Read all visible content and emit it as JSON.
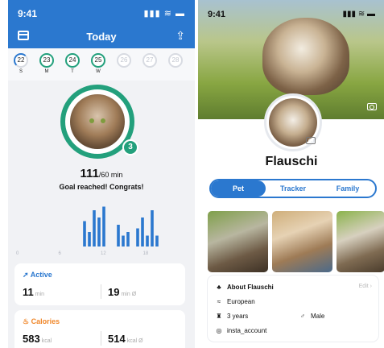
{
  "left": {
    "status_time": "9:41",
    "status_icons": "▮▮▮ ≋ ▬",
    "nav_title": "Today",
    "days": [
      {
        "num": "22",
        "label": "S",
        "state": "ring"
      },
      {
        "num": "23",
        "label": "M",
        "state": "done"
      },
      {
        "num": "24",
        "label": "T",
        "state": "done"
      },
      {
        "num": "25",
        "label": "W",
        "state": "done"
      },
      {
        "num": "26",
        "label": "",
        "state": "empty"
      },
      {
        "num": "27",
        "label": "",
        "state": "empty"
      },
      {
        "num": "28",
        "label": "",
        "state": "empty"
      }
    ],
    "streak_badge": "3",
    "goal_value": "111",
    "goal_unit": "/60 min",
    "goal_message": "Goal reached! Congrats!",
    "active": {
      "title": "Active",
      "value1": "11",
      "unit1": "min",
      "value2": "19",
      "unit2": "min Ø"
    },
    "calories": {
      "title": "Calories",
      "value1": "583",
      "unit1": "kcal",
      "value2": "514",
      "unit2": "kcal Ø"
    }
  },
  "right": {
    "status_time": "9:41",
    "status_icons": "▮▮▮ ≋ ▬",
    "pet_name": "Flauschi",
    "tabs": [
      {
        "label": "Pet",
        "active": true
      },
      {
        "label": "Tracker",
        "active": false
      },
      {
        "label": "Family",
        "active": false
      }
    ],
    "about_title": "About Flauschi",
    "edit_label": "Edit",
    "breed": "European",
    "age": "3 years",
    "gender": "Male",
    "instagram": "insta_account"
  },
  "chart_data": {
    "type": "bar",
    "x_ticks": [
      "0",
      "6",
      "12",
      "18"
    ],
    "values": [
      0,
      0,
      0,
      0,
      0,
      0,
      0,
      0,
      0,
      0,
      0,
      0,
      0,
      0,
      7,
      4,
      10,
      8,
      11,
      0,
      0,
      6,
      3,
      4,
      0,
      5,
      8,
      3,
      10,
      3,
      0,
      0,
      0,
      0,
      0
    ],
    "ylim": [
      0,
      12
    ],
    "color": "#2b78cf"
  }
}
